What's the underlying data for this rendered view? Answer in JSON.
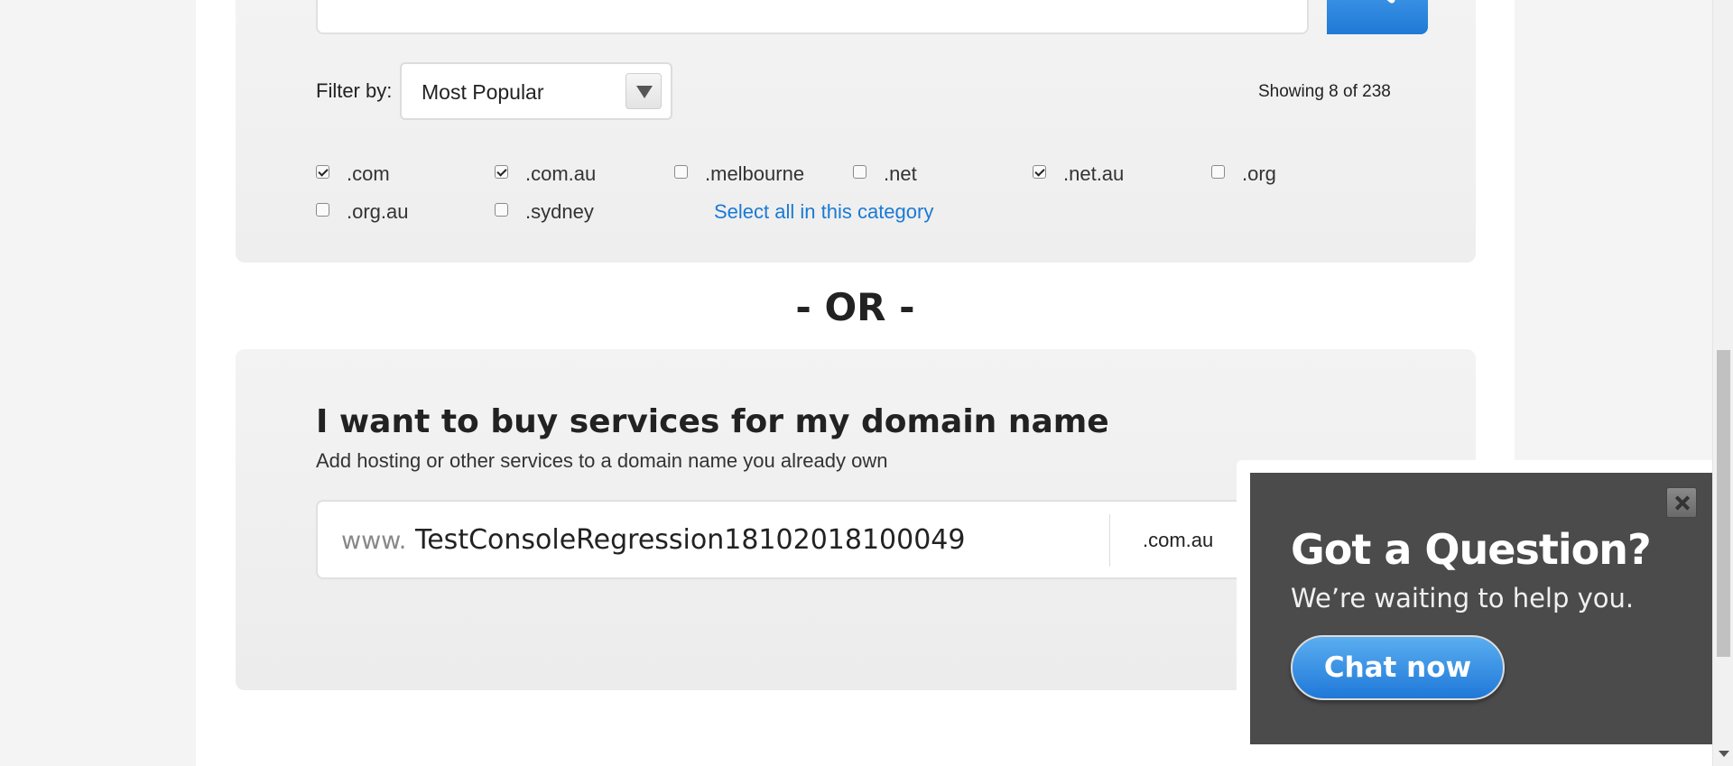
{
  "search": {
    "button_icon": "search-icon"
  },
  "filter": {
    "label": "Filter by:",
    "selected": "Most Popular",
    "showing": "Showing 8 of 238"
  },
  "tlds": [
    {
      "label": ".com",
      "checked": true
    },
    {
      "label": ".com.au",
      "checked": true
    },
    {
      "label": ".melbourne",
      "checked": false
    },
    {
      "label": ".net",
      "checked": false
    },
    {
      "label": ".net.au",
      "checked": true
    },
    {
      "label": ".org",
      "checked": false
    },
    {
      "label": ".org.au",
      "checked": false
    },
    {
      "label": ".sydney",
      "checked": false
    }
  ],
  "select_all": "Select all in this category",
  "divider": "- OR -",
  "buy": {
    "title": "I want to buy services for my domain name",
    "subtitle": "Add hosting or other services to a domain name you already own",
    "prefix": "www.",
    "domain_value": "TestConsoleRegression18102018100049",
    "tld_selected": ".com.au"
  },
  "chat": {
    "title": "Got a Question?",
    "subtitle": "We’re waiting to help you.",
    "button": "Chat now",
    "accent": "#1f78d8"
  }
}
